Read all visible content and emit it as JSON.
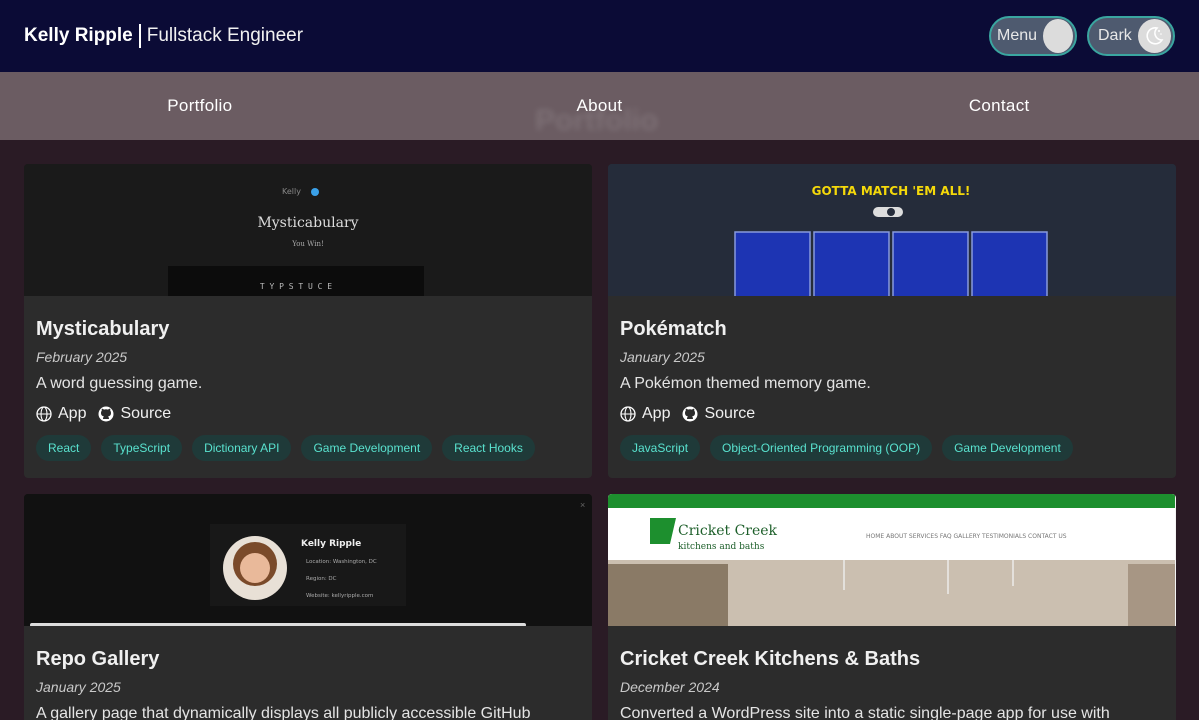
{
  "header": {
    "name": "Kelly Ripple",
    "title": "Fullstack Engineer",
    "menu_label": "Menu",
    "dark_label": "Dark"
  },
  "nav": {
    "items": [
      "Portfolio",
      "About",
      "Contact"
    ]
  },
  "ghost_title": "Portfolio",
  "cards": [
    {
      "title": "Mysticabulary",
      "date": "February 2025",
      "desc": "A word guessing game.",
      "app_label": "App",
      "source_label": "Source",
      "tags": [
        "React",
        "TypeScript",
        "Dictionary API",
        "Game Development",
        "React Hooks"
      ],
      "thumb_text": {
        "top": "Kelly",
        "title": "Mysticabulary",
        "sub": "You Win!",
        "bottom": "T Y P S T U C E"
      }
    },
    {
      "title": "Pokématch",
      "date": "January 2025",
      "desc": "A Pokémon themed memory game.",
      "app_label": "App",
      "source_label": "Source",
      "tags": [
        "JavaScript",
        "Object-Oriented Programming (OOP)",
        "Game Development"
      ],
      "thumb_text": {
        "title": "GOTTA MATCH 'EM ALL!"
      }
    },
    {
      "title": "Repo Gallery",
      "date": "January 2025",
      "desc": "A gallery page that dynamically displays all publicly accessible GitHub",
      "thumb_text": {
        "name": "Kelly Ripple",
        "loc": "Location: Washington, DC",
        "region": "Region: DC",
        "site": "Website: kellyripple.com"
      }
    },
    {
      "title": "Cricket Creek Kitchens & Baths",
      "date": "December 2024",
      "desc": "Converted a WordPress site into a static single-page app for use with",
      "thumb_text": {
        "logo": "Cricket Creek",
        "logo_sub": "kitchens and baths",
        "nav": "HOME  ABOUT  SERVICES  FAQ  GALLERY  TESTIMONIALS  CONTACT US"
      }
    }
  ],
  "colors": {
    "header_bg": "#0b0b36",
    "nav_bg": "#6b5c62",
    "page_bg": "#2a1b25",
    "card_bg": "#2c2c2c",
    "tag_text": "#59e2cf",
    "tag_bg": "#1f3a39"
  }
}
